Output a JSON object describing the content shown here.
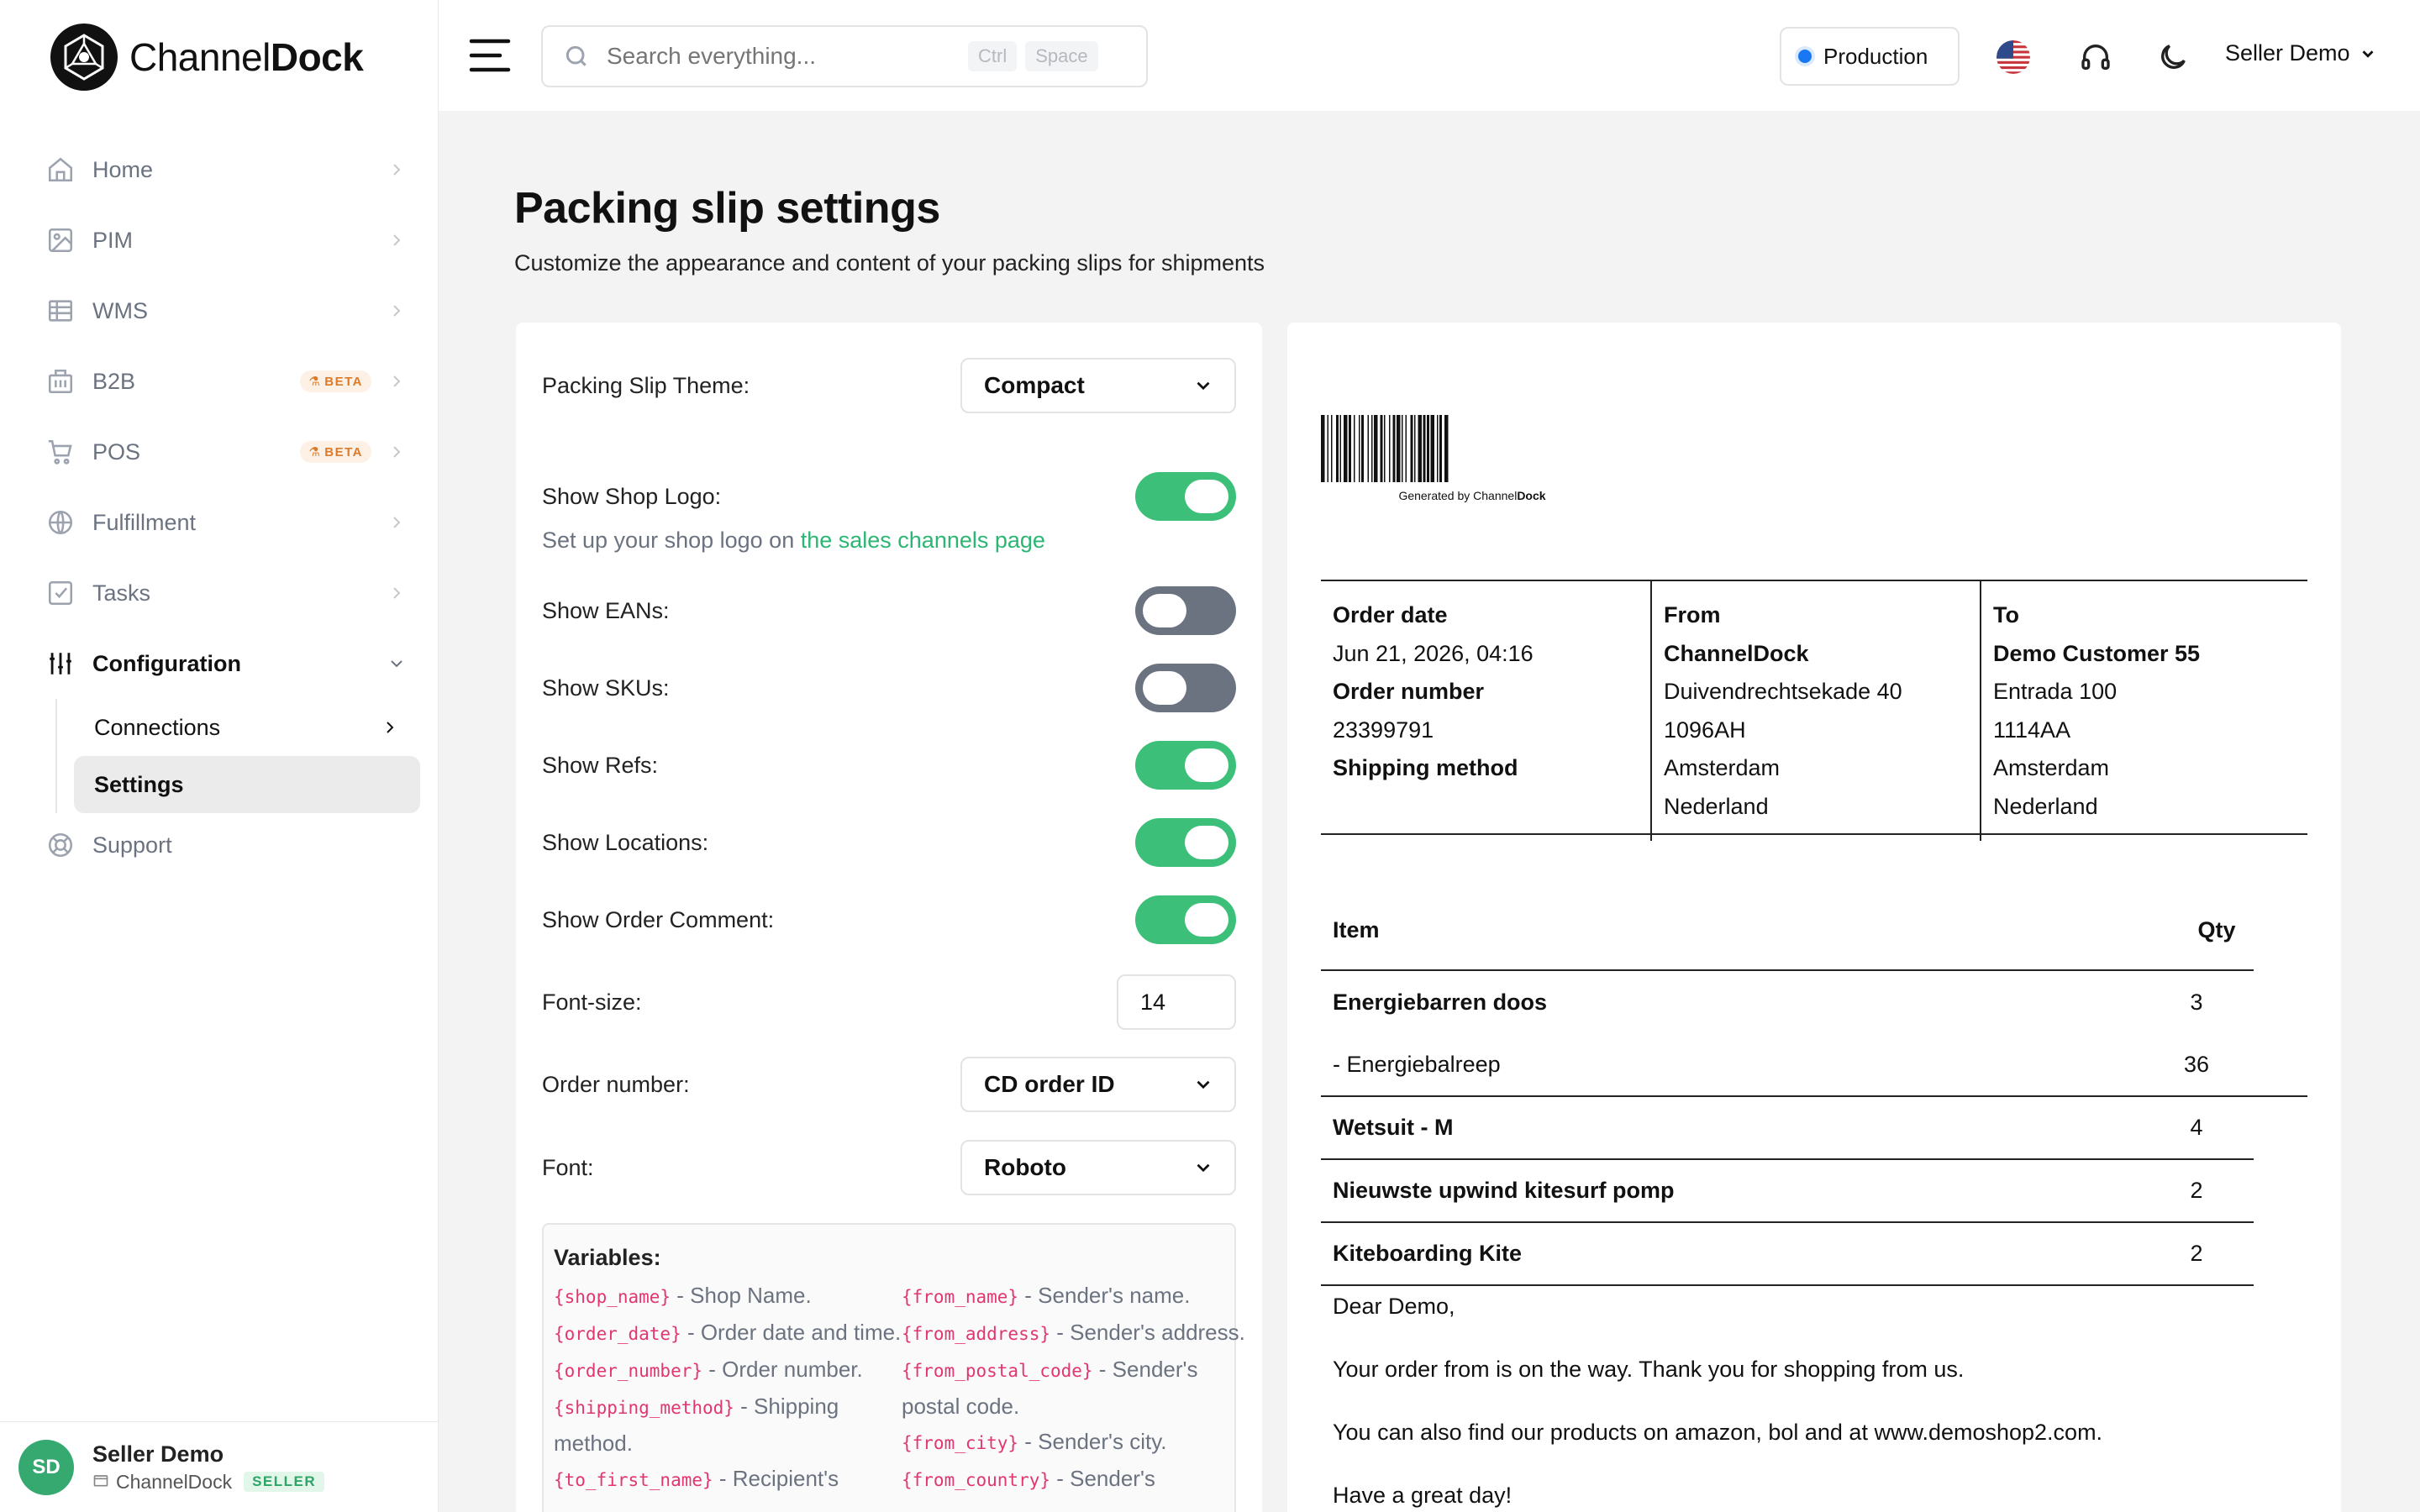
{
  "brand": {
    "name_light": "Channel",
    "name_bold": "Dock"
  },
  "sidebar": {
    "items": [
      {
        "label": "Home",
        "icon": "home-icon"
      },
      {
        "label": "PIM",
        "icon": "image-icon"
      },
      {
        "label": "WMS",
        "icon": "grid-icon"
      },
      {
        "label": "B2B",
        "icon": "building-icon",
        "badge": "BETA"
      },
      {
        "label": "POS",
        "icon": "cart-icon",
        "badge": "BETA"
      },
      {
        "label": "Fulfillment",
        "icon": "globe-icon"
      },
      {
        "label": "Tasks",
        "icon": "checkbox-icon"
      },
      {
        "label": "Configuration",
        "icon": "sliders-icon"
      }
    ],
    "sub_items": [
      {
        "label": "Connections"
      },
      {
        "label": "Settings"
      }
    ],
    "support": {
      "label": "Support",
      "icon": "lifebuoy-icon"
    },
    "user": {
      "initials": "SD",
      "name": "Seller Demo",
      "org": "ChannelDock",
      "role": "SELLER"
    }
  },
  "topbar": {
    "search_placeholder": "Search everything...",
    "kbd1": "Ctrl",
    "kbd2": "Space",
    "env": "Production",
    "user": "Seller Demo"
  },
  "page": {
    "title": "Packing slip settings",
    "subtitle": "Customize the appearance and content of your packing slips for shipments"
  },
  "settings": {
    "theme_label": "Packing Slip Theme:",
    "theme_value": "Compact",
    "show_logo_label": "Show Shop Logo:",
    "show_logo": true,
    "logo_hint": "Set up your shop logo on ",
    "logo_hint_link": "the sales channels page",
    "show_eans_label": "Show EANs:",
    "show_eans": false,
    "show_skus_label": "Show SKUs:",
    "show_skus": false,
    "show_refs_label": "Show Refs:",
    "show_refs": true,
    "show_locations_label": "Show Locations:",
    "show_locations": true,
    "show_comment_label": "Show Order Comment:",
    "show_comment": true,
    "font_size_label": "Font-size:",
    "font_size": "14",
    "order_number_label": "Order number:",
    "order_number_value": "CD order ID",
    "font_label": "Font:",
    "font_value": "Roboto"
  },
  "variables": {
    "title": "Variables:",
    "left": [
      {
        "code": "{shop_name}",
        "desc": " - Shop Name."
      },
      {
        "code": "{order_date}",
        "desc": " - Order date and time."
      },
      {
        "code": "{order_number}",
        "desc": " - Order number."
      },
      {
        "code": "{shipping_method}",
        "desc": " - Shipping method."
      },
      {
        "code": "{to_first_name}",
        "desc": " - Recipient's"
      }
    ],
    "right": [
      {
        "code": "{from_name}",
        "desc": " - Sender's name."
      },
      {
        "code": "{from_address}",
        "desc": " - Sender's address."
      },
      {
        "code": "{from_postal_code}",
        "desc": " - Sender's postal code."
      },
      {
        "code": "{from_city}",
        "desc": " - Sender's city."
      },
      {
        "code": "{from_country}",
        "desc": " - Sender's"
      }
    ]
  },
  "preview": {
    "barcode_caption_prefix": "Generated by Channel",
    "barcode_caption_bold": "Dock",
    "order_date_label": "Order date",
    "order_date": "Jun 21, 2026, 04:16",
    "order_number_label": "Order number",
    "order_number": "23399791",
    "shipping_method_label": "Shipping method",
    "from_label": "From",
    "from": [
      "ChannelDock",
      "Duivendrechtsekade 40",
      "1096AH",
      "Amsterdam",
      "Nederland"
    ],
    "to_label": "To",
    "to": [
      "Demo Customer 55",
      "Entrada 100",
      "1114AA",
      "Amsterdam",
      "Nederland"
    ],
    "item_header": "Item",
    "qty_header": "Qty",
    "items": [
      {
        "name": "Energiebarren doos",
        "qty": "3"
      },
      {
        "name": "- Energiebalreep",
        "qty": "36"
      },
      {
        "name": "Wetsuit - M",
        "qty": "4"
      },
      {
        "name": "Nieuwste upwind kitesurf pomp",
        "qty": "2"
      },
      {
        "name": "Kiteboarding Kite",
        "qty": "2"
      }
    ],
    "letter": [
      "Dear Demo,",
      "Your order from is on the way. Thank you for shopping from us.",
      "You can also find our products on amazon, bol and at www.demoshop2.com.",
      "Have a great day!"
    ]
  }
}
